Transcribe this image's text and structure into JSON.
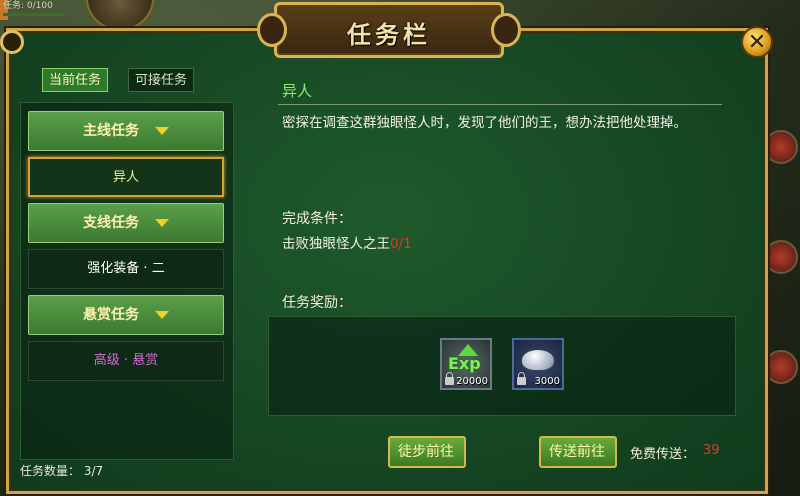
{
  "hud": {
    "status": "任务: 0/100"
  },
  "window": {
    "title": "任务栏"
  },
  "tabs": [
    {
      "label": "当前任务",
      "active": true
    },
    {
      "label": "可接任务",
      "active": false
    }
  ],
  "categories": {
    "main": {
      "label": "主线任务",
      "item": "异人"
    },
    "side": {
      "label": "支线任务",
      "item": "强化装备 · 二"
    },
    "bounty": {
      "label": "悬赏任务",
      "item": "高级 · 悬赏"
    }
  },
  "task_count": "任务数量： 3/7",
  "quest": {
    "title": "异人",
    "description": "密探在调查这群独眼怪人时，发现了他们的王，想办法把他处理掉。",
    "condition_label": "完成条件：",
    "condition_text": "击败独眼怪人之王",
    "condition_progress": "0/1",
    "reward_label": "任务奖励："
  },
  "rewards": [
    {
      "icon": "exp-icon",
      "text": "Exp",
      "amount": "20000"
    },
    {
      "icon": "silver-ingot-icon",
      "amount": "3000"
    }
  ],
  "buttons": {
    "walk": "徒步前往",
    "teleport": "传送前往",
    "free_label": "免费传送：",
    "free_count": "39"
  },
  "colors": {
    "accent_gold": "#d8b456",
    "quest_title": "#8fef6f",
    "progress_red": "#e03a2a",
    "bounty_item": "#d86ad8",
    "side_item": "#ffffff",
    "selected_border": "#d8a030"
  }
}
